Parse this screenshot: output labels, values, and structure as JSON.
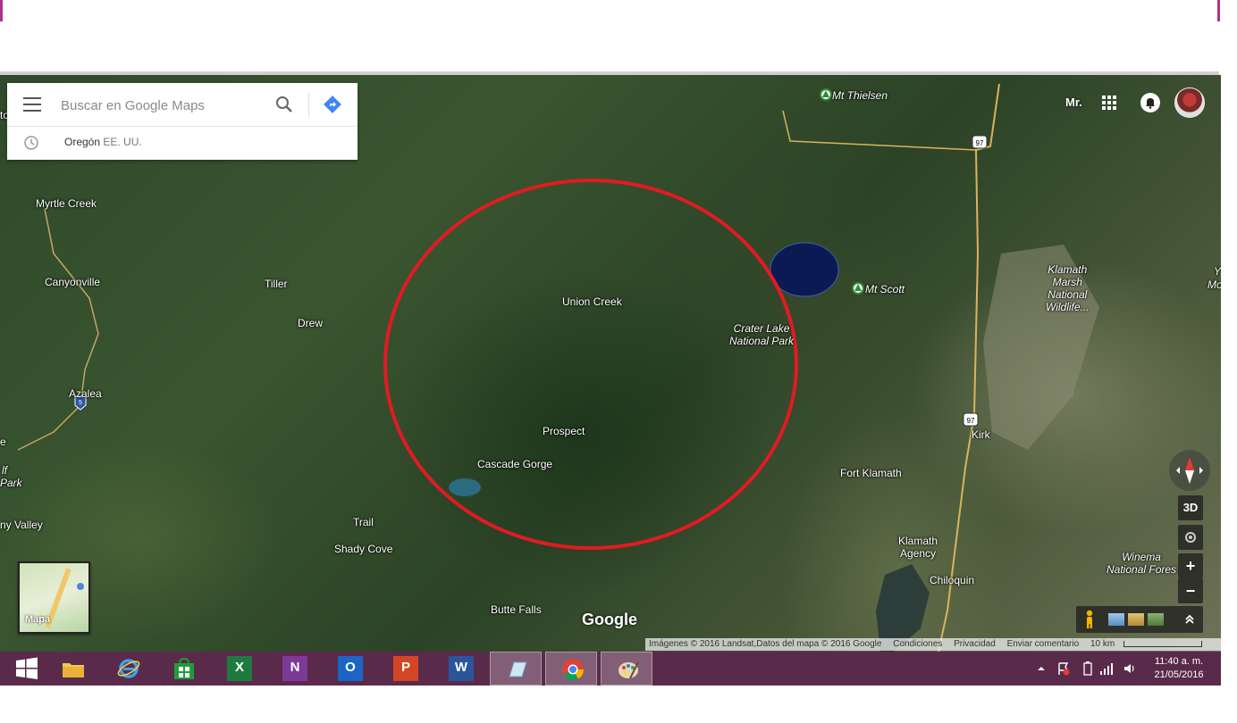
{
  "search": {
    "placeholder": "Buscar en Google Maps",
    "recent_place": "Oregón",
    "recent_sub": "EE. UU."
  },
  "account": {
    "label": "Mr."
  },
  "map": {
    "places": {
      "mt_thielsen": "Mt Thielsen",
      "myrtle_creek": "Myrtle Creek",
      "canyonville": "Canyonville",
      "tiller": "Tiller",
      "drew": "Drew",
      "azalea": "Azalea",
      "union_creek": "Union Creek",
      "prospect": "Prospect",
      "cascade_gorge": "Cascade Gorge",
      "trail": "Trail",
      "shady_cove": "Shady Cove",
      "butte_falls": "Butte Falls",
      "crater_lake_1": "Crater Lake",
      "crater_lake_2": "National Park",
      "mt_scott": "Mt Scott",
      "klamath_marsh_1": "Klamath",
      "klamath_marsh_2": "Marsh",
      "klamath_marsh_3": "National",
      "klamath_marsh_4": "Wildlife...",
      "kirk": "Kirk",
      "fort_klamath": "Fort Klamath",
      "klamath_agency_1": "Klamath",
      "klamath_agency_2": "Agency",
      "chiloquin": "Chiloquin",
      "winema_1": "Winema",
      "winema_2": "National Fores",
      "ny_valley": "ny Valley",
      "lf": "lf",
      "park": "Park",
      "e_edge": "e",
      "y_edge": "Y",
      "mo_edge": "Mo",
      "to_edge": "to"
    },
    "shields": {
      "hwy97_a": "97",
      "hwy97_b": "97",
      "i5": "5"
    },
    "circle_color": "#e11b22"
  },
  "controls": {
    "btn_3d": "3D",
    "zoom_in": "+",
    "zoom_out": "−",
    "minimap_label": "Mapa"
  },
  "branding": {
    "logo": "Google"
  },
  "attribution": {
    "imagery": "Imágenes © 2016 Landsat,Datos del mapa © 2016 Google",
    "terms": "Condiciones",
    "privacy": "Privacidad",
    "feedback": "Enviar comentario",
    "scale": "10 km"
  },
  "taskbar": {
    "time": "11:40 a. m.",
    "date": "21/05/2016",
    "excel": "X",
    "onenote": "N",
    "outlook": "O",
    "powerpoint": "P",
    "word": "W"
  }
}
